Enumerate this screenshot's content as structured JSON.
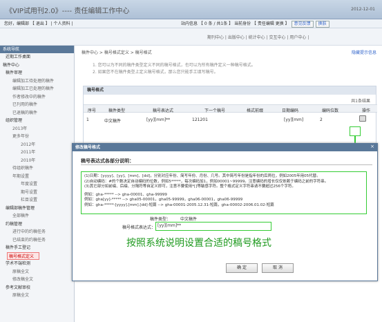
{
  "header": {
    "title": "《VIP试用刊2.0》---- 责任编辑工作中心",
    "date": "2012-12-01"
  },
  "userbar": {
    "left": "您好，编辑部 【 退出 】 | 个人资料 |",
    "msg": "站内信息 【 0 条 / 共1条 】 当前身份 【 责任编辑 更换 】",
    "feedback": "意见反馈",
    "switch": "换肤"
  },
  "topmenu": "期刊中心 | 出版中心 | 统计中心 | 交互中心 | 用户中心 |",
  "sidebar": {
    "title": "系统导航",
    "items": [
      {
        "label": "近期工作桌面",
        "lvl": "l1"
      },
      {
        "label": "稿件中心",
        "lvl": "l0"
      },
      {
        "label": "稿件审理",
        "lvl": "l1"
      },
      {
        "label": "编辑加工待处理的稿件",
        "lvl": "l2"
      },
      {
        "label": "编辑加工已处理的稿件",
        "lvl": "l2"
      },
      {
        "label": "作者修改中的稿件",
        "lvl": "l2"
      },
      {
        "label": "已刊用的稿件",
        "lvl": "l2"
      },
      {
        "label": "已退稿的稿件",
        "lvl": "l2"
      },
      {
        "label": "组织管理",
        "lvl": "l1"
      },
      {
        "label": "2013年",
        "lvl": "l2"
      },
      {
        "label": "更多年份",
        "lvl": "l2"
      },
      {
        "label": "2012年",
        "lvl": "l3"
      },
      {
        "label": "2011年",
        "lvl": "l3"
      },
      {
        "label": "2010年",
        "lvl": "l3"
      },
      {
        "label": "待组织稿件",
        "lvl": "l2"
      },
      {
        "label": "年期设置",
        "lvl": "l2"
      },
      {
        "label": "年度设置",
        "lvl": "l3"
      },
      {
        "label": "期号设置",
        "lvl": "l3"
      },
      {
        "label": "栏目设置",
        "lvl": "l3"
      },
      {
        "label": "编辑部稿件管理",
        "lvl": "l1"
      },
      {
        "label": "全部稿件",
        "lvl": "l2"
      },
      {
        "label": "约稿管理",
        "lvl": "l1"
      },
      {
        "label": "进行中的约稿任务",
        "lvl": "l2"
      },
      {
        "label": "已结束的约稿任务",
        "lvl": "l2"
      },
      {
        "label": "稿件手工登记",
        "lvl": "l1"
      },
      {
        "label": "稿号格式定义",
        "lvl": "active"
      },
      {
        "label": "学术不端检测",
        "lvl": "l1"
      },
      {
        "label": "原稿全文",
        "lvl": "l2"
      },
      {
        "label": "修改稿全文",
        "lvl": "l2"
      },
      {
        "label": "参考文献审校",
        "lvl": "l1"
      },
      {
        "label": "原稿全文",
        "lvl": "l2"
      }
    ]
  },
  "main": {
    "breadcrumb": "稿件中心 > 稿号格式定义 > 稿号格式",
    "hide_tips": "隐藏提示信息",
    "tips": [
      "1. 您可以为不同的稿件类型定义不同的稿号格式，也可以为所有稿件定义一种稿号格式。",
      "2. 如果您不在稿件类型上定义稿号格式，那么您只能手工填写稿号。"
    ],
    "panel_title": "稿号格式",
    "count": "共1条结果",
    "columns": [
      "序号",
      "稿件类型",
      "稿号表达式",
      "下一个稿号",
      "格式前缀",
      "日期编码",
      "编码位数",
      "操作"
    ],
    "row": [
      "1",
      "中文稿件",
      "[yy][mm]**",
      "121201",
      "",
      "[yy][mm]",
      "2",
      ""
    ]
  },
  "dialog": {
    "title": "修改稿号格式",
    "close": "×",
    "section": "稿号表达式各部分说明：",
    "lines": [
      "(1)日期：[yyyy]、[yy]、[mm]、[dd]，分别对应年份、简写年份、月份、几号。其中简写年份是指年份的后两位，例如2005年用05代替。",
      "(2)自动编码：#的个数决定自动编码的位数，例如5*****，每次编码加1，例如00001~99999。注意编码的增长仅仅依赖于编码之前的字符串。",
      "(3)其它部分如前缀、后缀、分隔符等自定义即可，注意不要使用*[]等敏感字符。整个格式定义字符串请不要超过256个字符。",
      "",
      "例如：gha-*****  -->  gha-00001、gha-99999",
      "例如：gha[yy]-*****  -->  gha05-00001，gha05-99999，gha06-00001，gha06-99999",
      "例如：gha-*****-[yyyy].[mm].[dd]-短篇  -->  gha-00001-2005.12.31-短篇，gha-00002-2006.01.02-短篇"
    ],
    "type_label": "稿件类型：",
    "type_value": "中文稿件",
    "expr_label": "稿号格式表达式：",
    "expr_value": "[yy][mm]**",
    "big_note": "按照系统说明设置合适的稿号格式",
    "ok": "确 定",
    "cancel": "取 消"
  }
}
